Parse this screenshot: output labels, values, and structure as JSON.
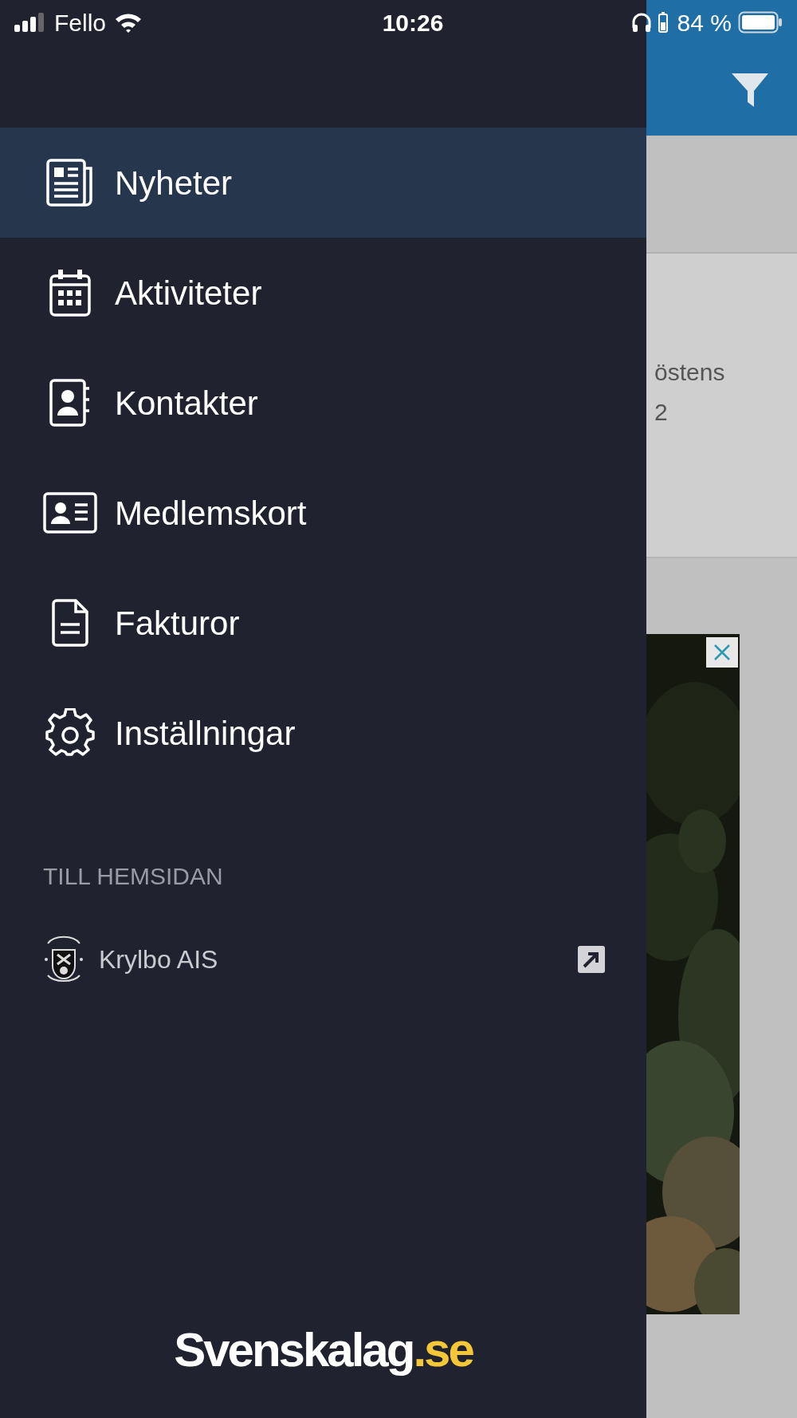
{
  "status_bar": {
    "carrier": "Fello",
    "time": "10:26",
    "battery": "84 %"
  },
  "menu": [
    {
      "label": "Nyheter",
      "selected": true
    },
    {
      "label": "Aktiviteter",
      "selected": false
    },
    {
      "label": "Kontakter",
      "selected": false
    },
    {
      "label": "Medlemskort",
      "selected": false
    },
    {
      "label": "Fakturor",
      "selected": false
    },
    {
      "label": "Inställningar",
      "selected": false
    }
  ],
  "website_section": {
    "title": "TILL HEMSIDAN",
    "links": [
      {
        "label": "Krylbo AIS"
      }
    ]
  },
  "footer_logo": {
    "name": "Svenskalag",
    "domain": ".se"
  },
  "background_page": {
    "text_lines": [
      "östens",
      "2"
    ]
  }
}
